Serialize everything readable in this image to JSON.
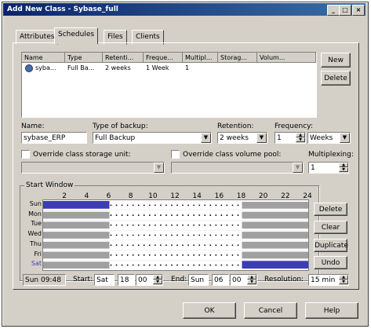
{
  "window": {
    "title": "Add New Class - Sybase_full",
    "controls": [
      "_",
      "□",
      "×"
    ]
  },
  "tabs": [
    {
      "label": "Attributes",
      "active": false
    },
    {
      "label": "Schedules",
      "active": true
    },
    {
      "label": "Files",
      "active": false
    },
    {
      "label": "Clients",
      "active": false
    }
  ],
  "schedule_list": {
    "columns": [
      "Name",
      "Type",
      "Retenti...",
      "Freque...",
      "Multipl...",
      "Storag...",
      "Volum..."
    ],
    "rows": [
      {
        "icon": "schedule-clock-icon",
        "cells": [
          "syba...",
          "Full Ba...",
          "2 weeks",
          "1 Week",
          "1",
          "",
          ""
        ]
      }
    ],
    "buttons": {
      "new": "New",
      "delete": "Delete"
    }
  },
  "form": {
    "name_label": "Name:",
    "name_value": "sybase_ERP",
    "type_label": "Type of backup:",
    "type_value": "Full Backup",
    "retention_label": "Retention:",
    "retention_value": "2 weeks",
    "frequency_label": "Frequency:",
    "frequency_value": "1",
    "frequency_unit": "Weeks",
    "override_storage_label": "Override class storage unit:",
    "override_volume_label": "Override class volume pool:",
    "multiplexing_label": "Multiplexing:",
    "multiplexing_value": "1"
  },
  "start_window": {
    "label": "Start Window",
    "hours": [
      "2",
      "4",
      "6",
      "8",
      "10",
      "12",
      "14",
      "16",
      "18",
      "20",
      "22",
      "24"
    ],
    "days": [
      "Sun",
      "Mon",
      "Tue",
      "Wed",
      "Thu",
      "Fri",
      "Sat"
    ],
    "buttons": {
      "delete": "Delete",
      "clear": "Clear",
      "duplicate": "Duplicate",
      "undo": "Undo"
    },
    "cursor_time": "Sun 09:48",
    "start_label": "Start:",
    "start_day": "Sat",
    "start_hour": "18",
    "start_min": "00",
    "end_label": "End:",
    "end_day": "Sun",
    "end_hour": "06",
    "end_min": "00",
    "resolution_label": "Resolution:",
    "resolution_value": "15 min"
  },
  "footer": {
    "ok": "OK",
    "cancel": "Cancel",
    "help": "Help"
  },
  "colors": {
    "title_bar": "#0a246a",
    "window_bg": "#d4d0c8",
    "selection_fill": "#3c3cb4",
    "weekend_fill": "#a0a0a0"
  }
}
